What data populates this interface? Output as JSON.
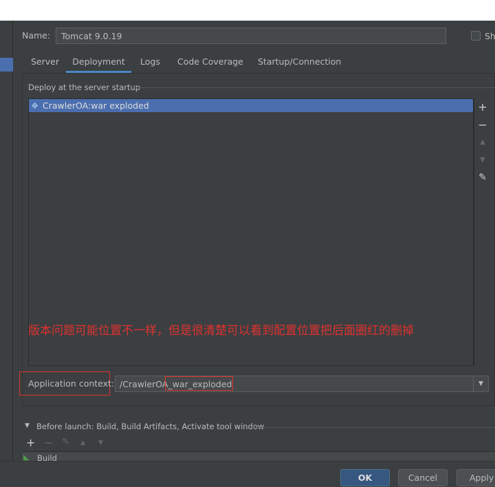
{
  "name_label": "Name:",
  "name_value": "Tomcat 9.0.19",
  "share_label": "Sh",
  "tabs": [
    "Server",
    "Deployment",
    "Logs",
    "Code Coverage",
    "Startup/Connection"
  ],
  "deploy_group_label": "Deploy at the server startup",
  "deploy_items": [
    "CrawlerOA:war exploded"
  ],
  "annotation": "版本问题可能位置不一样，但是很清楚可以看到配置位置把后面圈红的删掉",
  "app_context_label": "Application context:",
  "app_context_prefix": "/CrawlerOA",
  "app_context_suffix": "_war_exploded",
  "before_launch_label": "Before launch: Build, Build Artifacts, Activate tool window",
  "before_launch_items": [
    "Build"
  ],
  "buttons": {
    "ok": "OK",
    "cancel": "Cancel",
    "apply": "Apply"
  },
  "colors": {
    "accent": "#4b6eaf",
    "annotation": "#e0312f",
    "background": "#3c3f41"
  }
}
